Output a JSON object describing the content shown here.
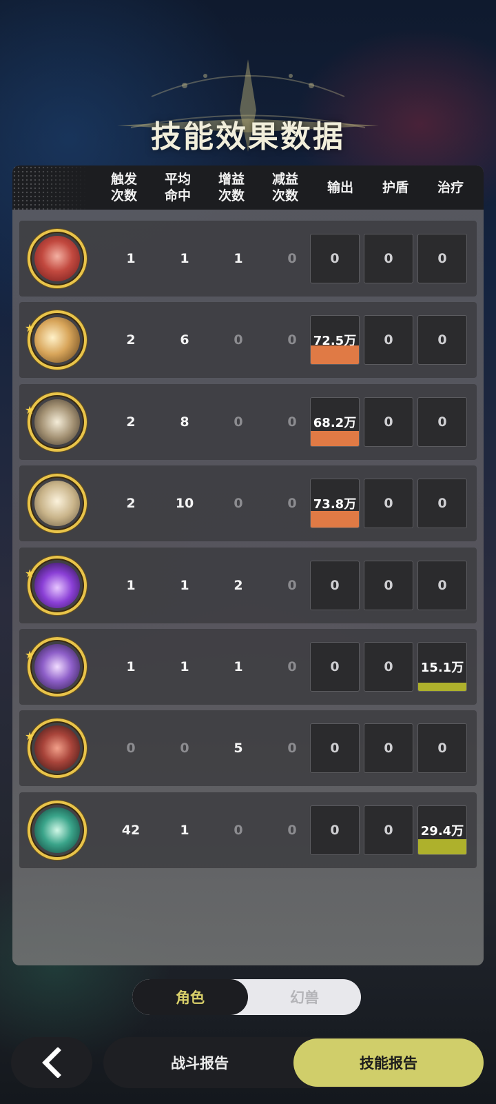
{
  "title": "技能效果数据",
  "columns": [
    "触发\n次数",
    "平均\n命中",
    "增益\n次数",
    "减益\n次数",
    "输出",
    "护盾",
    "治疗"
  ],
  "colors": {
    "damage_bar": "#e07a45",
    "heal_bar": "#aeb12c",
    "accent": "#d0ce6a",
    "icon_border": "#e9c44a"
  },
  "rows": [
    {
      "icon": "skill-red-warrior-icon",
      "starred": false,
      "trigger": "1",
      "hit": "1",
      "buff": "1",
      "debuff": "0",
      "output": "0",
      "shield": "0",
      "heal": "0"
    },
    {
      "icon": "skill-golden-slash-icon",
      "starred": true,
      "trigger": "2",
      "hit": "6",
      "buff": "0",
      "debuff": "0",
      "output": "72.5万",
      "output_fill": 0.37,
      "shield": "0",
      "heal": "0"
    },
    {
      "icon": "skill-whirlwind-icon",
      "starred": true,
      "trigger": "2",
      "hit": "8",
      "buff": "0",
      "debuff": "0",
      "output": "68.2万",
      "output_fill": 0.3,
      "shield": "0",
      "heal": "0"
    },
    {
      "icon": "skill-tornado-icon",
      "starred": false,
      "trigger": "2",
      "hit": "10",
      "buff": "0",
      "debuff": "0",
      "output": "73.8万",
      "output_fill": 0.33,
      "shield": "0",
      "heal": "0"
    },
    {
      "icon": "skill-purple-flame-icon",
      "starred": true,
      "trigger": "1",
      "hit": "1",
      "buff": "2",
      "debuff": "0",
      "output": "0",
      "shield": "0",
      "heal": "0"
    },
    {
      "icon": "skill-purple-orb-icon",
      "starred": true,
      "trigger": "1",
      "hit": "1",
      "buff": "1",
      "debuff": "0",
      "output": "0",
      "shield": "0",
      "heal": "15.1万",
      "heal_fill": 0.16
    },
    {
      "icon": "skill-red-armor-icon",
      "starred": true,
      "trigger": "0",
      "hit": "0",
      "buff": "5",
      "debuff": "0",
      "output": "0",
      "shield": "0",
      "heal": "0"
    },
    {
      "icon": "skill-green-heal-icon",
      "starred": false,
      "trigger": "42",
      "hit": "1",
      "buff": "0",
      "debuff": "0",
      "output": "0",
      "shield": "0",
      "heal": "29.4万",
      "heal_fill": 0.3
    }
  ],
  "toggle": {
    "active": "角色",
    "inactive": "幻兽"
  },
  "footer": {
    "back_icon": "chevron-left-icon",
    "tab_battle_report": "战斗报告",
    "tab_skill_report": "技能报告"
  }
}
